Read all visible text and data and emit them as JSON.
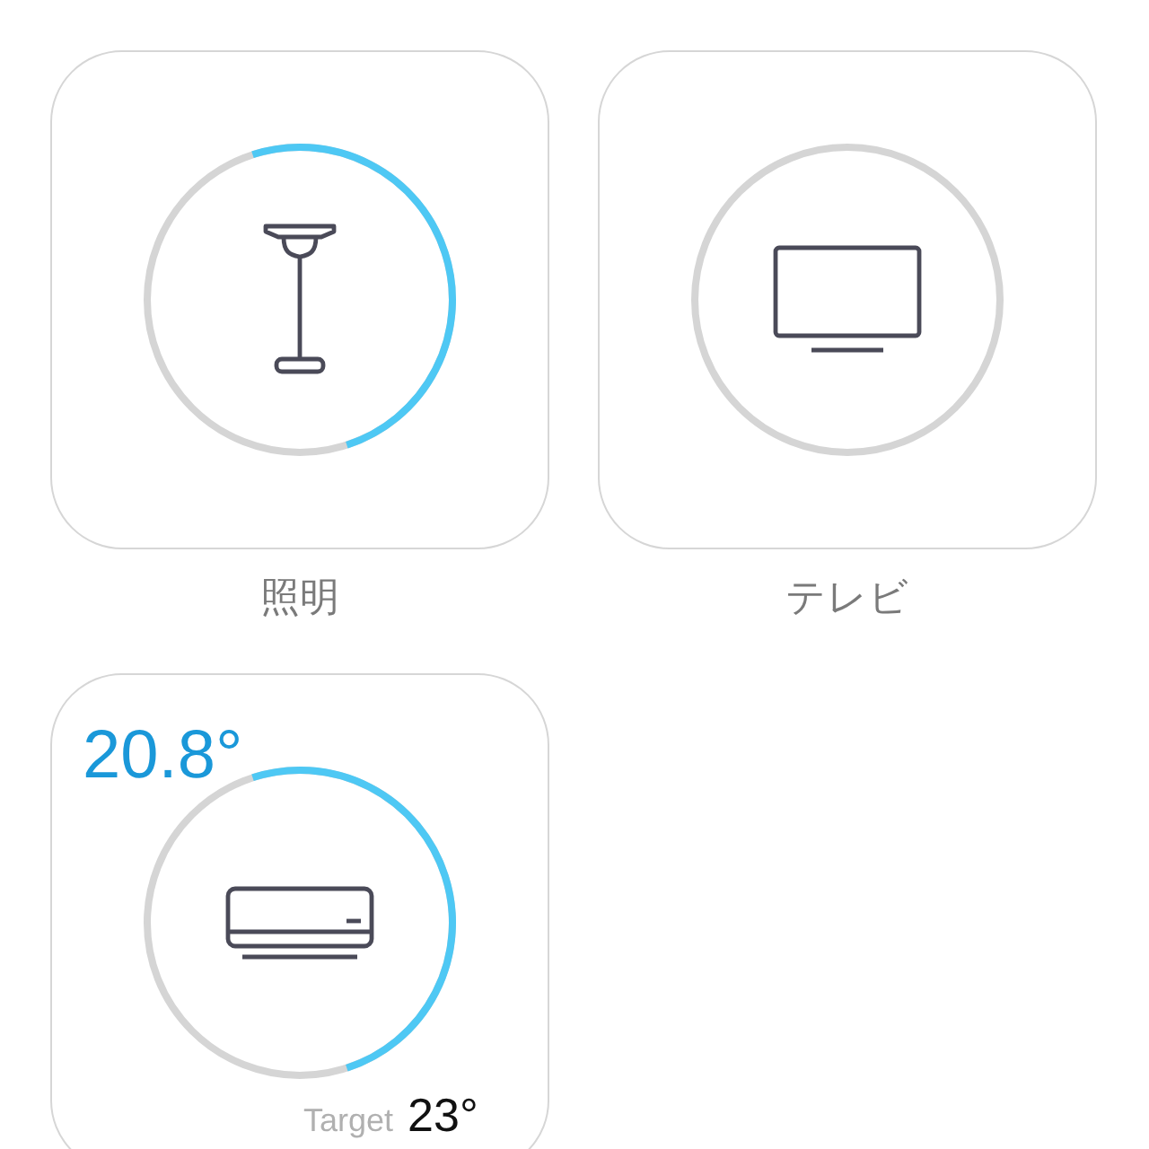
{
  "devices": [
    {
      "kind": "light",
      "name": "照明",
      "level": 0.5
    },
    {
      "kind": "tv",
      "name": "テレビ"
    },
    {
      "kind": "climate",
      "current": "20.8°",
      "target_label": "Target",
      "target": "23°",
      "level": 0.5
    }
  ]
}
